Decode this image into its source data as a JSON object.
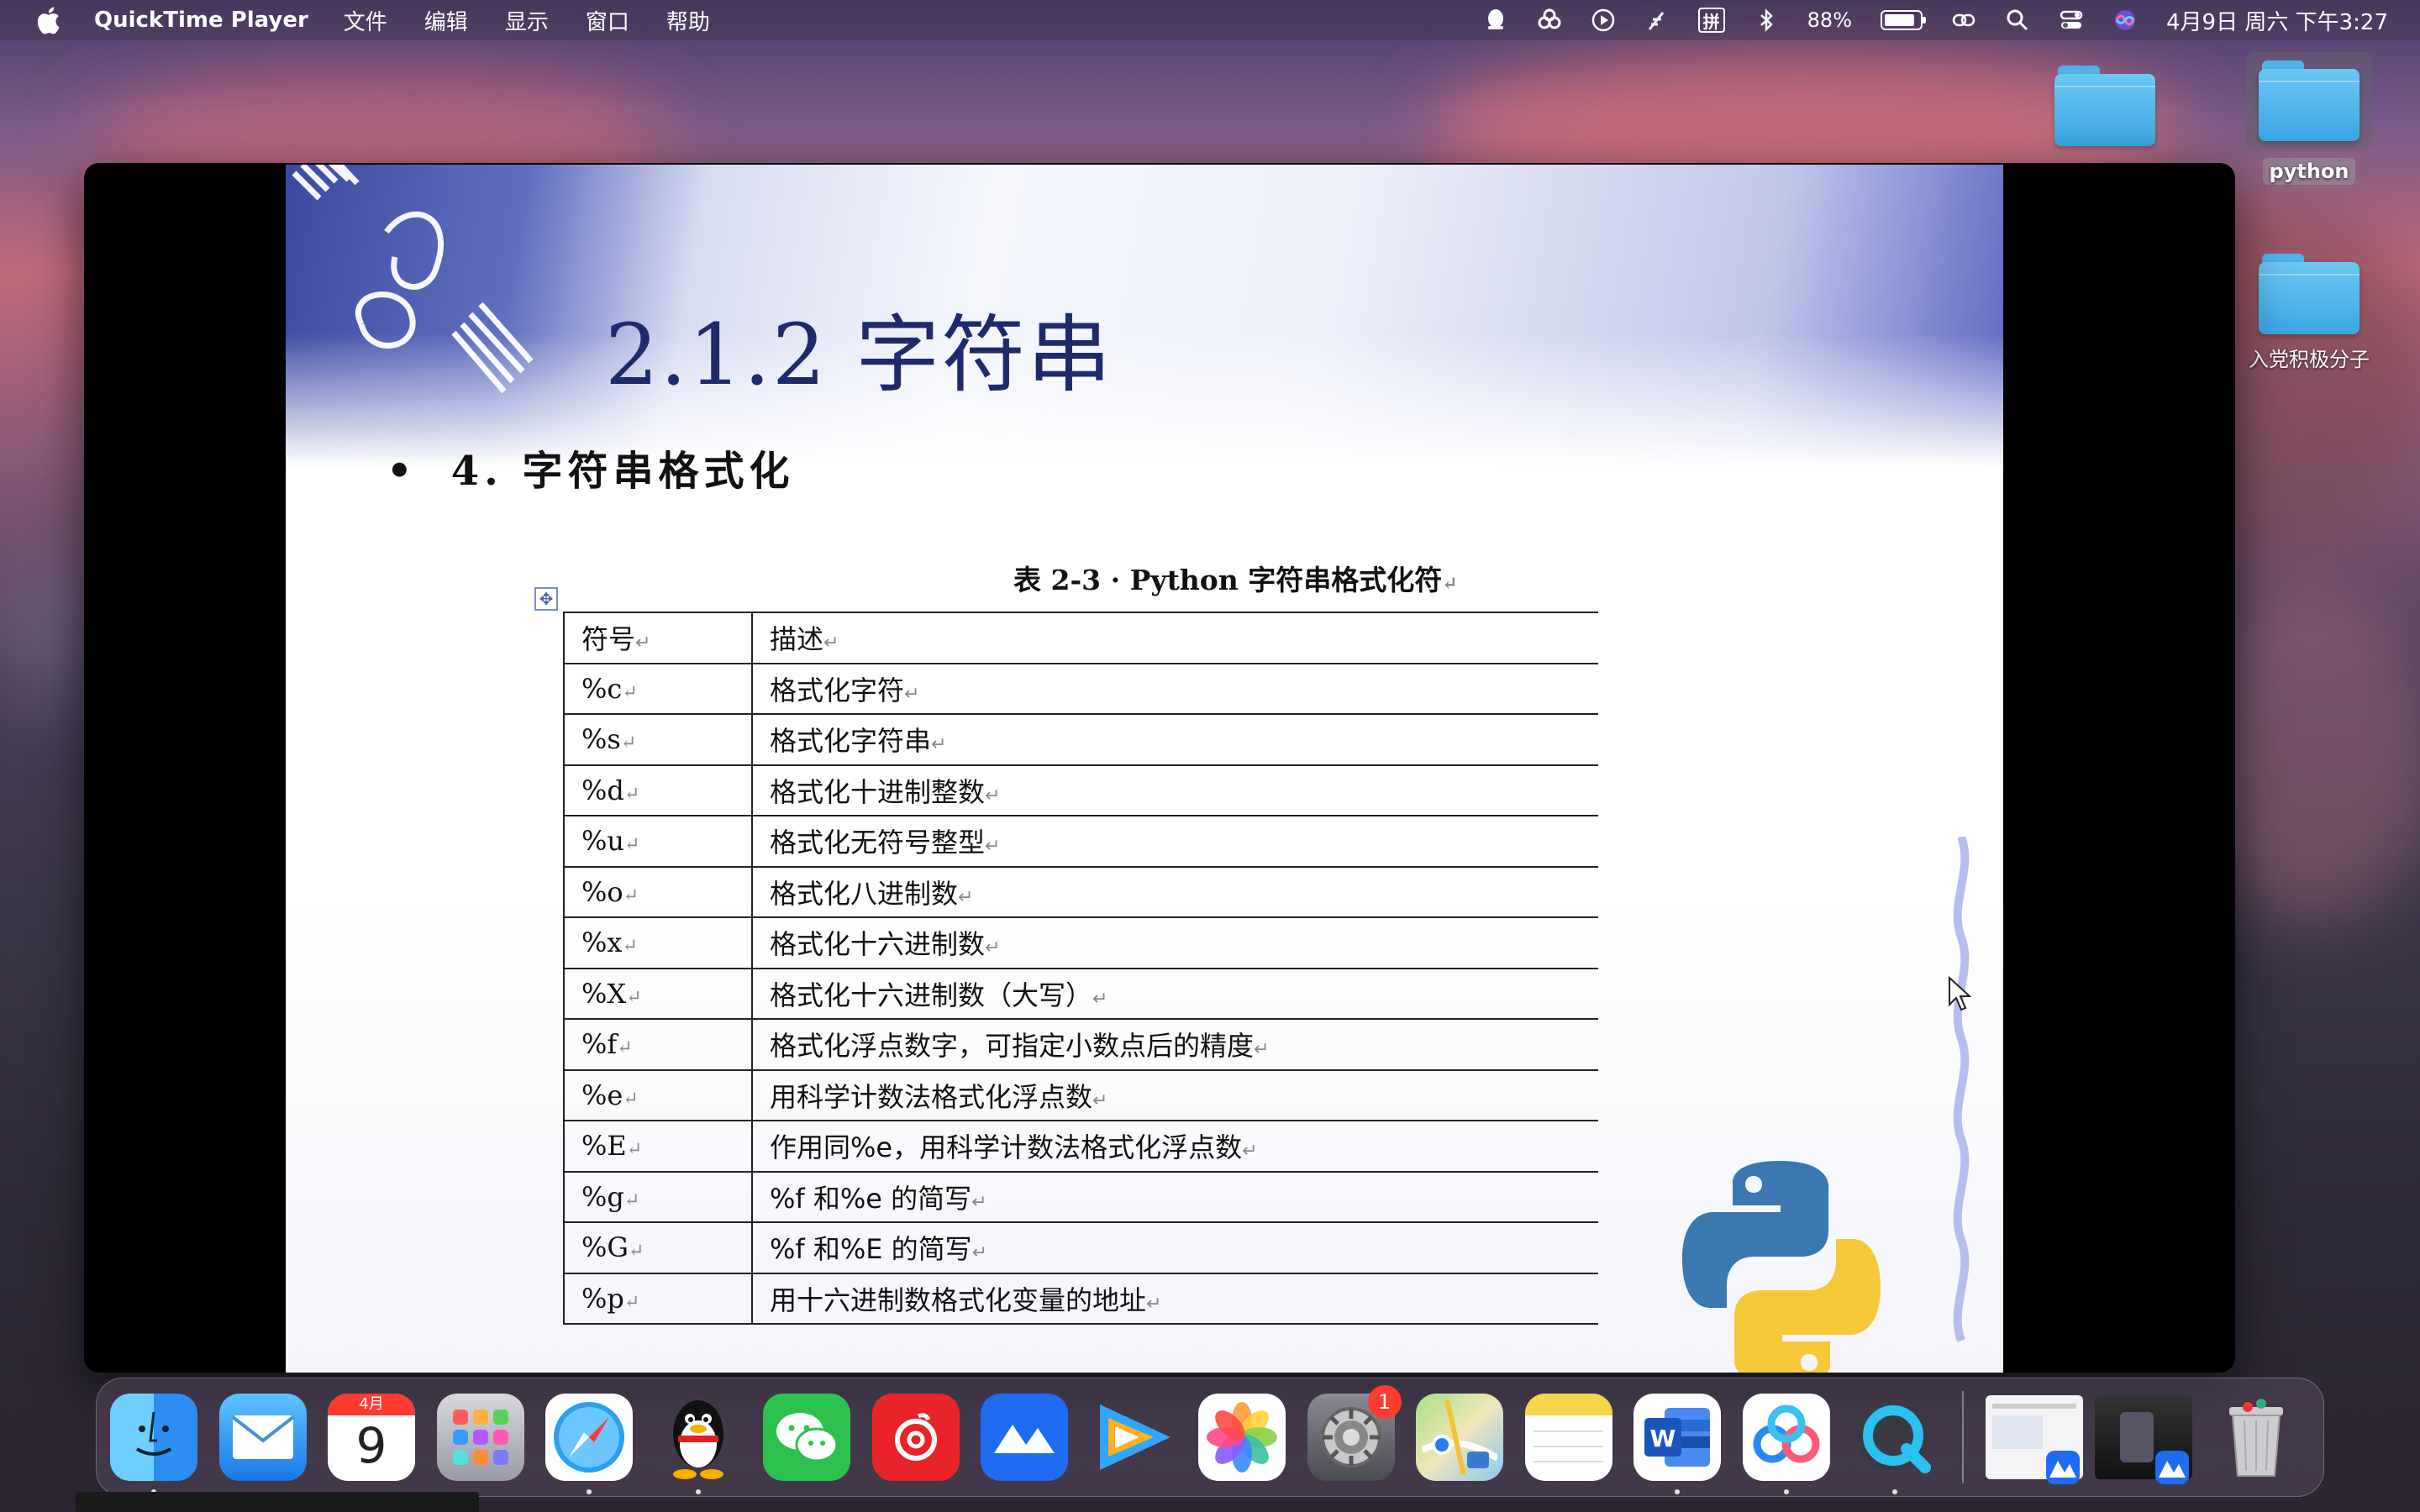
{
  "menubar": {
    "app_name": "QuickTime Player",
    "menus": [
      "文件",
      "编辑",
      "显示",
      "窗口",
      "帮助"
    ],
    "battery_percent": "88%",
    "ime_label": "拼",
    "clock": "4月9日 周六 下午3:27"
  },
  "desktop": {
    "icons": [
      {
        "label": ""
      },
      {
        "label": "python"
      },
      {
        "label": "入党积极分子"
      }
    ]
  },
  "slide": {
    "title": "2.1.2  字符串",
    "bullet_marker": "•",
    "bullet_text": "4.  字符串格式化",
    "table_caption": "表 2-3 · Python 字符串格式化符",
    "paragraph_mark": "↵",
    "header": {
      "symbol": "符号",
      "description": "描述"
    },
    "rows": [
      {
        "symbol": "%c",
        "description": "格式化字符"
      },
      {
        "symbol": "%s",
        "description": "格式化字符串"
      },
      {
        "symbol": "%d",
        "description": "格式化十进制整数"
      },
      {
        "symbol": "%u",
        "description": "格式化无符号整型"
      },
      {
        "symbol": "%o",
        "description": "格式化八进制数"
      },
      {
        "symbol": "%x",
        "description": "格式化十六进制数"
      },
      {
        "symbol": "%X",
        "description": "格式化十六进制数（大写）"
      },
      {
        "symbol": "%f",
        "description": "格式化浮点数字，可指定小数点后的精度"
      },
      {
        "symbol": "%e",
        "description": "用科学计数法格式化浮点数"
      },
      {
        "symbol": "%E",
        "description": "作用同%e，用科学计数法格式化浮点数"
      },
      {
        "symbol": "%g",
        "description": "%f 和%e 的简写"
      },
      {
        "symbol": "%G",
        "description": "%f 和%E 的简写"
      },
      {
        "symbol": "%p",
        "description": "用十六进制数格式化变量的地址"
      }
    ]
  },
  "dock": {
    "calendar_month": "4月",
    "calendar_day": "9",
    "settings_badge": "1",
    "apps": [
      "finder",
      "mail",
      "calendar",
      "launchpad",
      "safari",
      "qq",
      "wechat",
      "netease-music",
      "lark",
      "tencent-video",
      "photos",
      "system-preferences",
      "maps",
      "notes",
      "word",
      "baidu-netdisk",
      "quicktime"
    ]
  },
  "colors": {
    "slide_title": "#1e2a6a",
    "folder": "#4fb3e8",
    "badge": "#ff3b30"
  }
}
